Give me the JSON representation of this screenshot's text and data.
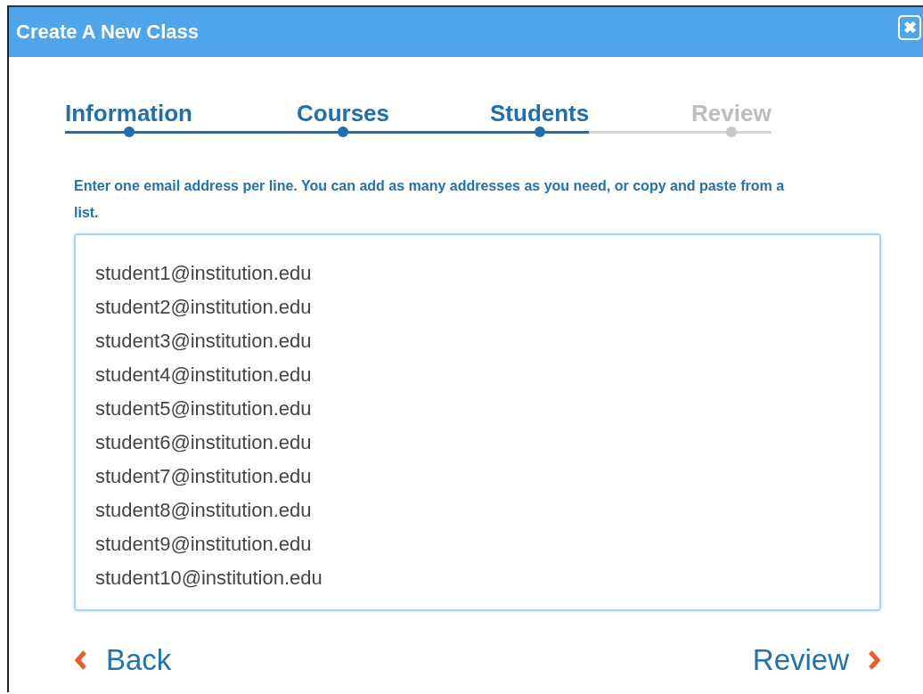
{
  "window": {
    "title": "Create A New Class",
    "close_label": "✖"
  },
  "steps": [
    {
      "label": "Information",
      "completed": true,
      "selected": false
    },
    {
      "label": "Courses",
      "completed": true,
      "selected": false
    },
    {
      "label": "Students",
      "completed": false,
      "selected": true
    },
    {
      "label": "Review",
      "completed": false,
      "selected": false
    }
  ],
  "instructions": "Enter one email address per line. You can add as many addresses as you need, or copy and paste from a list.",
  "email_field": {
    "value": [
      "student1@institution.edu",
      "student2@institution.edu",
      "student3@institution.edu",
      "student4@institution.edu",
      "student5@institution.edu",
      "student6@institution.edu",
      "student7@institution.edu",
      "student8@institution.edu",
      "student9@institution.edu",
      "student10@institution.edu"
    ]
  },
  "nav": {
    "back": "Back",
    "next": "Review"
  }
}
